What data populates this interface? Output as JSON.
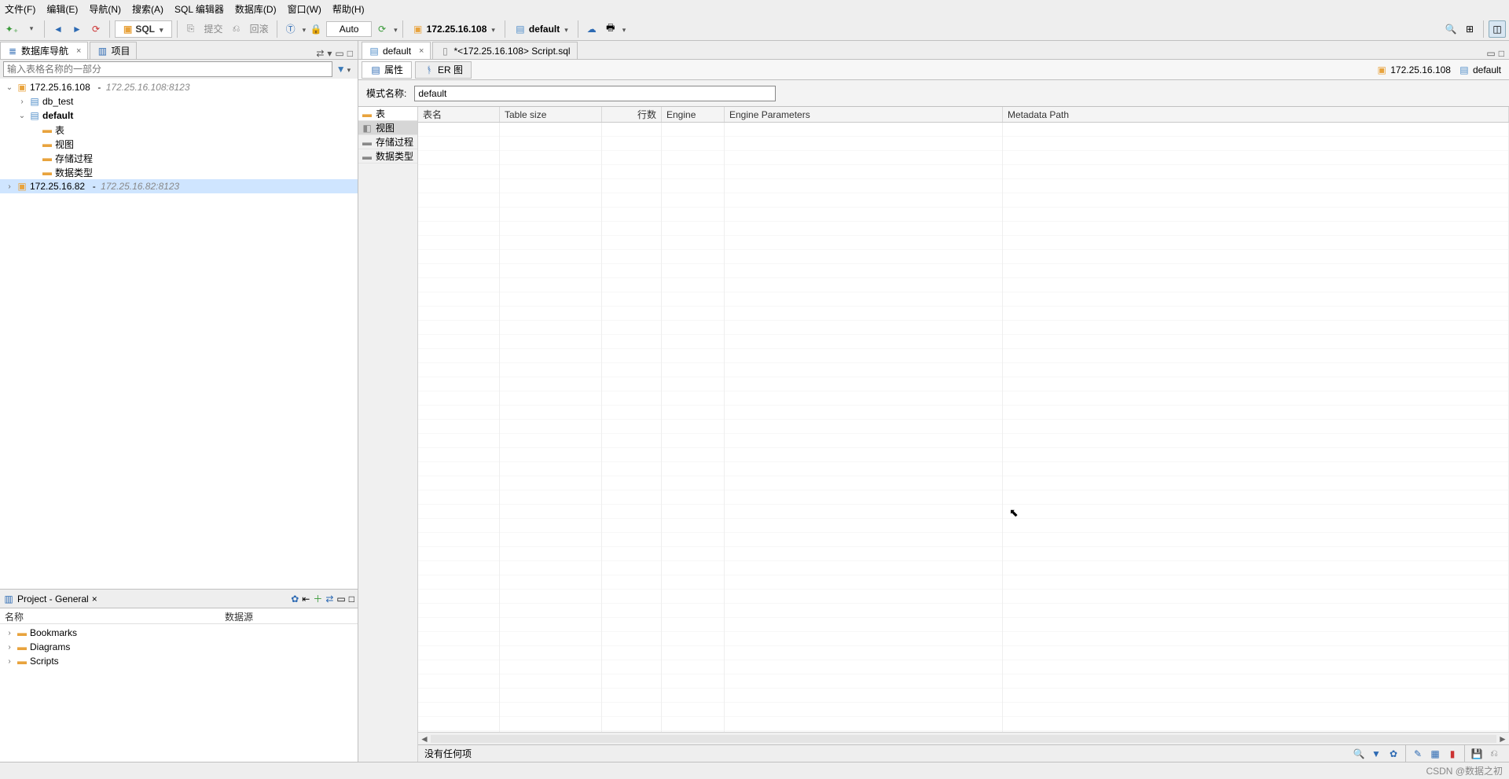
{
  "menu": {
    "file": "文件(F)",
    "edit": "编辑(E)",
    "nav": "导航(N)",
    "search": "搜索(A)",
    "sqleditor": "SQL 编辑器",
    "database": "数据库(D)",
    "window": "窗口(W)",
    "help": "帮助(H)"
  },
  "toolbar": {
    "sql": "SQL",
    "commit": "提交",
    "rollback": "回滚",
    "auto": "Auto",
    "connection": "172.25.16.108",
    "schema": "default"
  },
  "left": {
    "nav_tab": "数据库导航",
    "project_tab": "项目",
    "search_placeholder": "输入表格名称的一部分",
    "tree": {
      "conn1": "172.25.16.108",
      "conn1_meta": "172.25.16.108:8123",
      "db_test": "db_test",
      "default": "default",
      "tables": "表",
      "views": "视图",
      "procs": "存储过程",
      "types": "数据类型",
      "conn2": "172.25.16.82",
      "conn2_meta": "172.25.16.82:8123"
    }
  },
  "project": {
    "title": "Project - General",
    "col_name": "名称",
    "col_ds": "数据源",
    "bookmarks": "Bookmarks",
    "diagrams": "Diagrams",
    "scripts": "Scripts"
  },
  "right": {
    "tab_default": "default",
    "tab_script": "*<172.25.16.108> Script.sql",
    "sub_props": "属性",
    "sub_er": "ER 图",
    "crumb_conn": "172.25.16.108",
    "crumb_schema": "default",
    "schema_label": "模式名称:",
    "schema_value": "default",
    "cats": {
      "tables": "表",
      "views": "视图",
      "procs": "存储过程",
      "types": "数据类型"
    },
    "cols": {
      "name": "表名",
      "size": "Table size",
      "rows": "行数",
      "engine": "Engine",
      "params": "Engine Parameters",
      "meta": "Metadata Path"
    },
    "status": "没有任何项"
  },
  "watermark": "CSDN @数据之初"
}
